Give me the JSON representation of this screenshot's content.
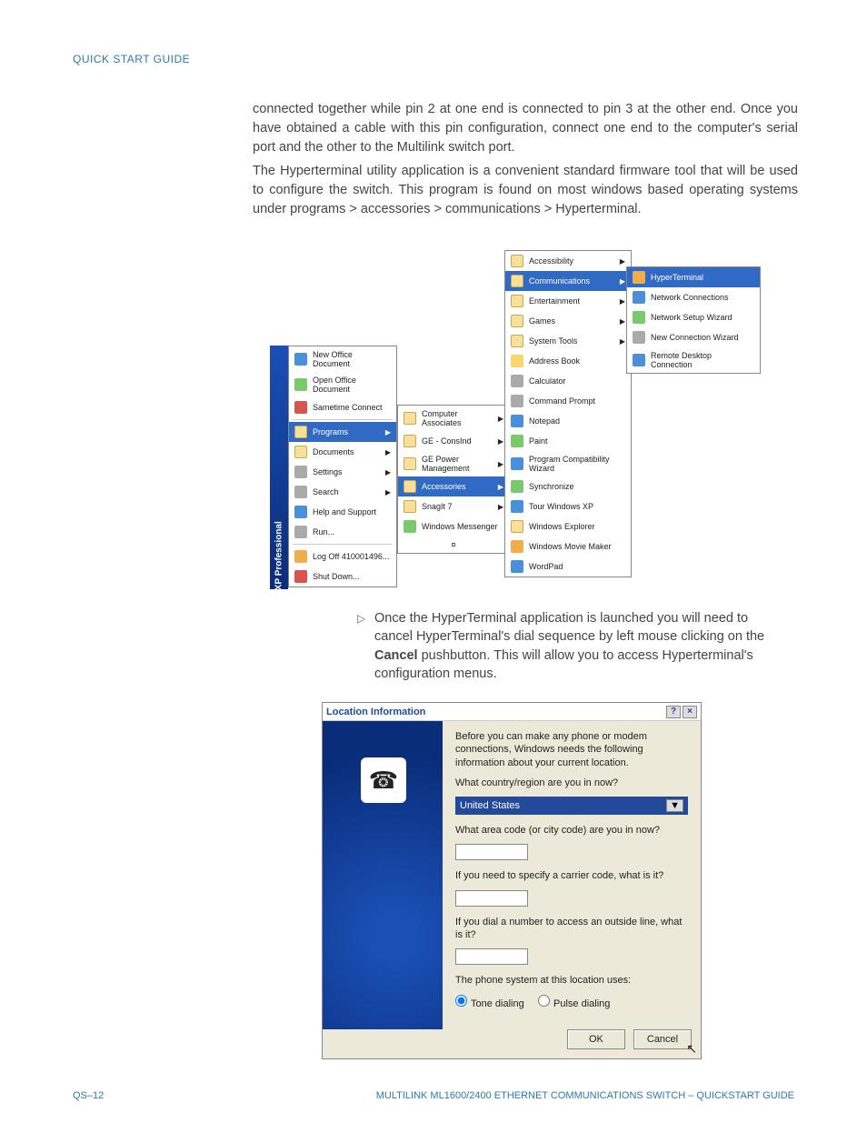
{
  "header": {
    "title": "QUICK START GUIDE"
  },
  "para1": "connected together while pin 2 at one end is connected to pin 3 at the other end. Once you have obtained a cable with this pin configuration, connect one end to the computer's serial port and the other to the Multilink switch port.",
  "para2": "The Hyperterminal utility application is a convenient standard firmware tool that will be used to configure the switch. This program is found on most windows based operating systems under programs > accessories > communications > Hyperterminal.",
  "step": {
    "pre": "Once the HyperTerminal application is launched you will need to cancel HyperTerminal's dial sequence by left mouse clicking on the ",
    "bold": "Cancel",
    "post": " pushbutton. This will allow you to access Hyperterminal's configuration menus."
  },
  "startmenu": {
    "vbar": "Windows XP Professional",
    "col1_top": [
      {
        "label": "New Office Document"
      },
      {
        "label": "Open Office Document"
      },
      {
        "label": "Sametime Connect"
      }
    ],
    "col1_main": [
      {
        "label": "Programs",
        "hl": true,
        "arrow": true
      },
      {
        "label": "Documents",
        "arrow": true
      },
      {
        "label": "Settings",
        "arrow": true
      },
      {
        "label": "Search",
        "arrow": true
      },
      {
        "label": "Help and Support"
      },
      {
        "label": "Run..."
      }
    ],
    "col1_bottom": [
      {
        "label": "Log Off 410001496..."
      },
      {
        "label": "Shut Down..."
      }
    ],
    "col2": [
      {
        "label": "Computer Associates",
        "arrow": true
      },
      {
        "label": "GE - ConsInd",
        "arrow": true
      },
      {
        "label": "GE Power Management",
        "arrow": true
      },
      {
        "label": "Accessories",
        "hl": true,
        "arrow": true
      },
      {
        "label": "SnagIt 7",
        "arrow": true
      },
      {
        "label": "Windows Messenger"
      },
      {
        "label": "¤"
      }
    ],
    "col3": [
      {
        "label": "Accessibility",
        "arrow": true
      },
      {
        "label": "Communications",
        "hl": true,
        "arrow": true
      },
      {
        "label": "Entertainment",
        "arrow": true
      },
      {
        "label": "Games",
        "arrow": true
      },
      {
        "label": "System Tools",
        "arrow": true
      },
      {
        "label": "Address Book"
      },
      {
        "label": "Calculator"
      },
      {
        "label": "Command Prompt"
      },
      {
        "label": "Notepad"
      },
      {
        "label": "Paint"
      },
      {
        "label": "Program Compatibility Wizard"
      },
      {
        "label": "Synchronize"
      },
      {
        "label": "Tour Windows XP"
      },
      {
        "label": "Windows Explorer"
      },
      {
        "label": "Windows Movie Maker"
      },
      {
        "label": "WordPad"
      }
    ],
    "col4": [
      {
        "label": "HyperTerminal",
        "hl": true
      },
      {
        "label": "Network Connections"
      },
      {
        "label": "Network Setup Wizard"
      },
      {
        "label": "New Connection Wizard"
      },
      {
        "label": "Remote Desktop Connection"
      }
    ]
  },
  "dialog": {
    "title": "Location Information",
    "intro": "Before you can make any phone or modem connections, Windows needs the following information about your current location.",
    "q_country": "What country/region are you in now?",
    "country": "United States",
    "q_area": "What area code (or city code) are you in now?",
    "q_carrier": "If you need to specify a carrier code, what is it?",
    "q_outside": "If you dial a number to access an outside line, what is it?",
    "phone_sys": "The phone system at this location uses:",
    "radio_tone": "Tone dialing",
    "radio_pulse": "Pulse dialing",
    "ok": "OK",
    "cancel": "Cancel"
  },
  "footer": {
    "left": "QS–12",
    "right": "MULTILINK ML1600/2400 ETHERNET COMMUNICATIONS SWITCH – QUICKSTART GUIDE"
  }
}
